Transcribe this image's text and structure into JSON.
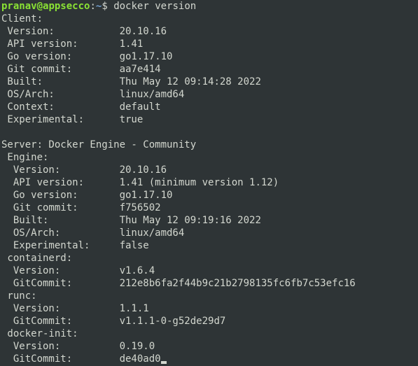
{
  "prompt": {
    "user": "pranav",
    "at": "@",
    "host": "appsecco",
    "colon": ":",
    "path": "~",
    "dollar": "$ "
  },
  "command": "docker version",
  "output": {
    "client_header": "Client:",
    "client": {
      "version_label": " Version:           ",
      "version_value": "20.10.16",
      "api_label": " API version:       ",
      "api_value": "1.41",
      "go_label": " Go version:        ",
      "go_value": "go1.17.10",
      "commit_label": " Git commit:        ",
      "commit_value": "aa7e414",
      "built_label": " Built:             ",
      "built_value": "Thu May 12 09:14:28 2022",
      "osarch_label": " OS/Arch:           ",
      "osarch_value": "linux/amd64",
      "context_label": " Context:           ",
      "context_value": "default",
      "experimental_label": " Experimental:      ",
      "experimental_value": "true"
    },
    "blank": "",
    "server_header": "Server: Docker Engine - Community",
    "engine_header": " Engine:",
    "engine": {
      "version_label": "  Version:          ",
      "version_value": "20.10.16",
      "api_label": "  API version:      ",
      "api_value": "1.41 (minimum version 1.12)",
      "go_label": "  Go version:       ",
      "go_value": "go1.17.10",
      "commit_label": "  Git commit:       ",
      "commit_value": "f756502",
      "built_label": "  Built:            ",
      "built_value": "Thu May 12 09:19:16 2022",
      "osarch_label": "  OS/Arch:          ",
      "osarch_value": "linux/amd64",
      "experimental_label": "  Experimental:     ",
      "experimental_value": "false"
    },
    "containerd_header": " containerd:",
    "containerd": {
      "version_label": "  Version:          ",
      "version_value": "v1.6.4",
      "commit_label": "  GitCommit:        ",
      "commit_value": "212e8b6fa2f44b9c21b2798135fc6fb7c53efc16"
    },
    "runc_header": " runc:",
    "runc": {
      "version_label": "  Version:          ",
      "version_value": "1.1.1",
      "commit_label": "  GitCommit:        ",
      "commit_value": "v1.1.1-0-g52de29d7"
    },
    "dockerinit_header": " docker-init:",
    "dockerinit": {
      "version_label": "  Version:          ",
      "version_value": "0.19.0",
      "commit_label": "  GitCommit:        ",
      "commit_value": "de40ad0"
    }
  }
}
